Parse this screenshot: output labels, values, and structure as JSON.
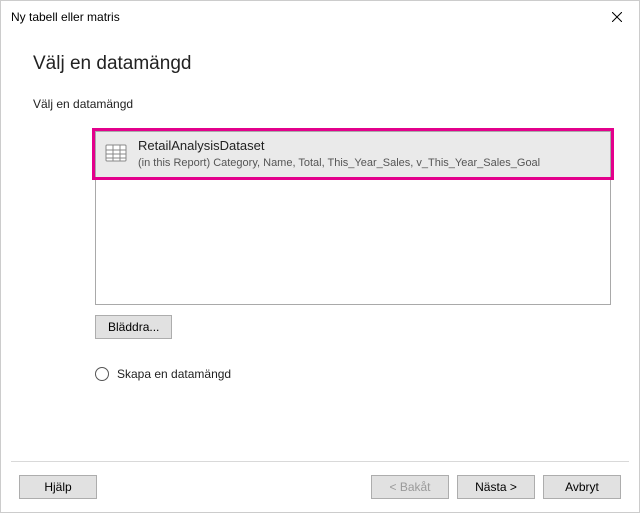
{
  "titlebar": {
    "title": "Ny tabell eller matris"
  },
  "main": {
    "heading": "Välj en datamängd",
    "section_label": "Välj en datamängd"
  },
  "dataset": {
    "name": "RetailAnalysisDataset",
    "description": "(in this Report) Category, Name, Total, This_Year_Sales, v_This_Year_Sales_Goal"
  },
  "browse": {
    "label": "Bläddra..."
  },
  "radio": {
    "create_label": "Skapa en datamängd"
  },
  "buttons": {
    "help": "Hjälp",
    "back": "< Bakåt",
    "next": "Nästa >",
    "cancel": "Avbryt"
  }
}
